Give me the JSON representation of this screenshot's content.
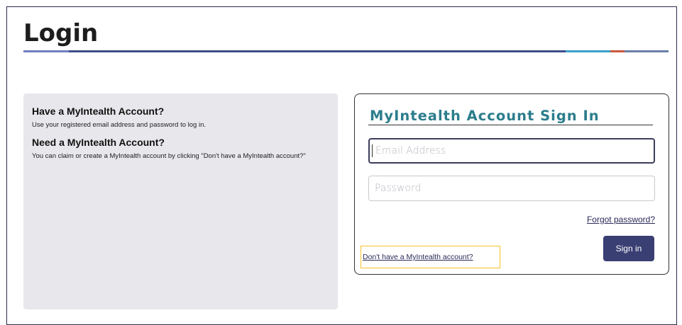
{
  "page": {
    "title": "Login"
  },
  "info_panel": {
    "have_account_heading": "Have a MyIntealth Account?",
    "have_account_text": "Use your registered email address and password to log in.",
    "need_account_heading": "Need a MyIntealth Account?",
    "need_account_text": "You can claim or create a MyIntealth account by clicking \"Don't have a MyIntealth account?\""
  },
  "signin_card": {
    "title": "MyIntealth Account Sign In",
    "email_placeholder": "Email Address",
    "email_value": "",
    "password_placeholder": "Password",
    "password_value": "",
    "forgot_password_label": "Forgot password?",
    "no_account_label": "Don't have a MyIntealth account?",
    "signin_button_label": "Sign in"
  },
  "colors": {
    "accent": "#3a3f73",
    "title_teal": "#2c7d8c",
    "highlight": "#f3c12c",
    "panel_bg": "#e8e8ec"
  }
}
